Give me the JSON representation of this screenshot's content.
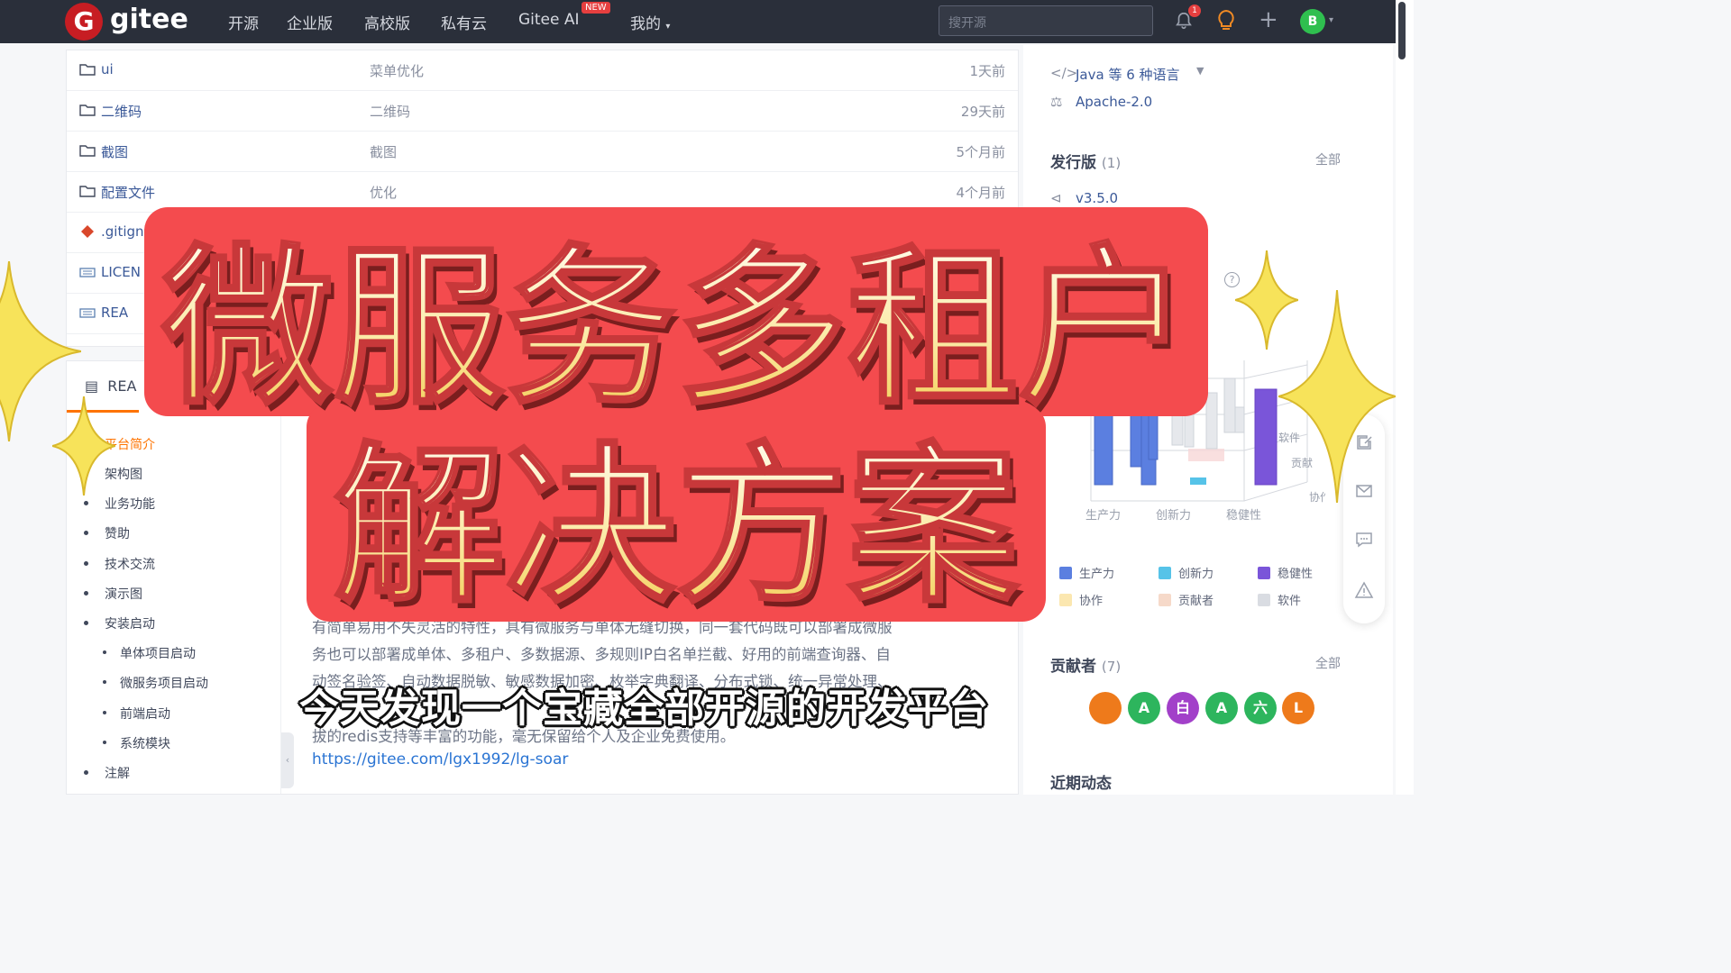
{
  "topbar": {
    "logo_letter": "G",
    "logo_text": "gitee",
    "nav": [
      "开源",
      "企业版",
      "高校版",
      "私有云",
      "Gitee AI",
      "我的"
    ],
    "new_badge": "NEW",
    "search_placeholder": "搜开源",
    "notification_count": "1",
    "user_initial": "B"
  },
  "files": [
    {
      "name": "ui",
      "message": "菜单优化",
      "time": "1天前",
      "type": "folder"
    },
    {
      "name": "二维码",
      "message": "二维码",
      "time": "29天前",
      "type": "folder"
    },
    {
      "name": "截图",
      "message": "截图",
      "time": "5个月前",
      "type": "folder"
    },
    {
      "name": "配置文件",
      "message": "优化",
      "time": "4个月前",
      "type": "folder"
    },
    {
      "name": ".gitign",
      "message": "",
      "time": "",
      "type": "git"
    },
    {
      "name": "LICEN",
      "message": "",
      "time": "",
      "type": "doc"
    },
    {
      "name": "REA",
      "message": "",
      "time": "",
      "type": "doc"
    }
  ],
  "readme": {
    "title": "REA",
    "toc": [
      "平台简介",
      "架构图",
      "业务功能",
      "赞助",
      "技术交流",
      "演示图",
      "安装启动",
      "单体项目启动",
      "微服务项目启动",
      "前端启动",
      "系统模块",
      "注解"
    ],
    "lines": [
      "有简单易用不失灵活的特性，具有微服务与单体无缝切换，同一套代码既可以部署成微服",
      "务也可以部署成单体、多租户、多数据源、多规则IP白名单拦截、好用的前端查询器、自",
      "动签名验签、自动数据脱敏、敏感数据加密、枚举字典翻译、分布式锁、统一异常处理、",
      "拔的redis支持等丰富的功能，毫无保留给个人及企业免费使用。"
    ],
    "link": "https://gitee.com/lgx1992/lg-soar"
  },
  "sidebar": {
    "languages": "Java 等 6 种语言",
    "license": "Apache-2.0",
    "releases_title": "发行版",
    "releases_count": "(1)",
    "releases_all": "全部",
    "release_tag": "v3.5.0",
    "contributors_title": "贡献者",
    "contributors_count": "(7)",
    "contributors_all": "全部",
    "activity_title": "近期动态",
    "contributors": [
      {
        "initial": "A",
        "color": "#2db55d"
      },
      {
        "initial": "白",
        "color": "#a240c9"
      },
      {
        "initial": "A",
        "color": "#2db55d"
      },
      {
        "initial": "六",
        "color": "#2db55d"
      },
      {
        "initial": "L",
        "color": "#ee7a1b"
      }
    ],
    "chart_axis": [
      "生产力",
      "创新力",
      "稳健性"
    ],
    "chart_side_labels": [
      "软件",
      "贡献",
      "协作"
    ],
    "legend": [
      {
        "label": "生产力",
        "color": "#5b7fe0"
      },
      {
        "label": "创新力",
        "color": "#56c3e8"
      },
      {
        "label": "稳健性",
        "color": "#7a55d9"
      },
      {
        "label": "协作",
        "color": "#fbe7b0"
      },
      {
        "label": "贡献者",
        "color": "#f6d9c9"
      },
      {
        "label": "软件",
        "color": "#d9dce2"
      }
    ]
  },
  "overlay": {
    "title_line1": "微服务多租户",
    "title_line2": "解决方案",
    "subtitle": "今天发现一个宝藏全部开源的开发平台"
  }
}
